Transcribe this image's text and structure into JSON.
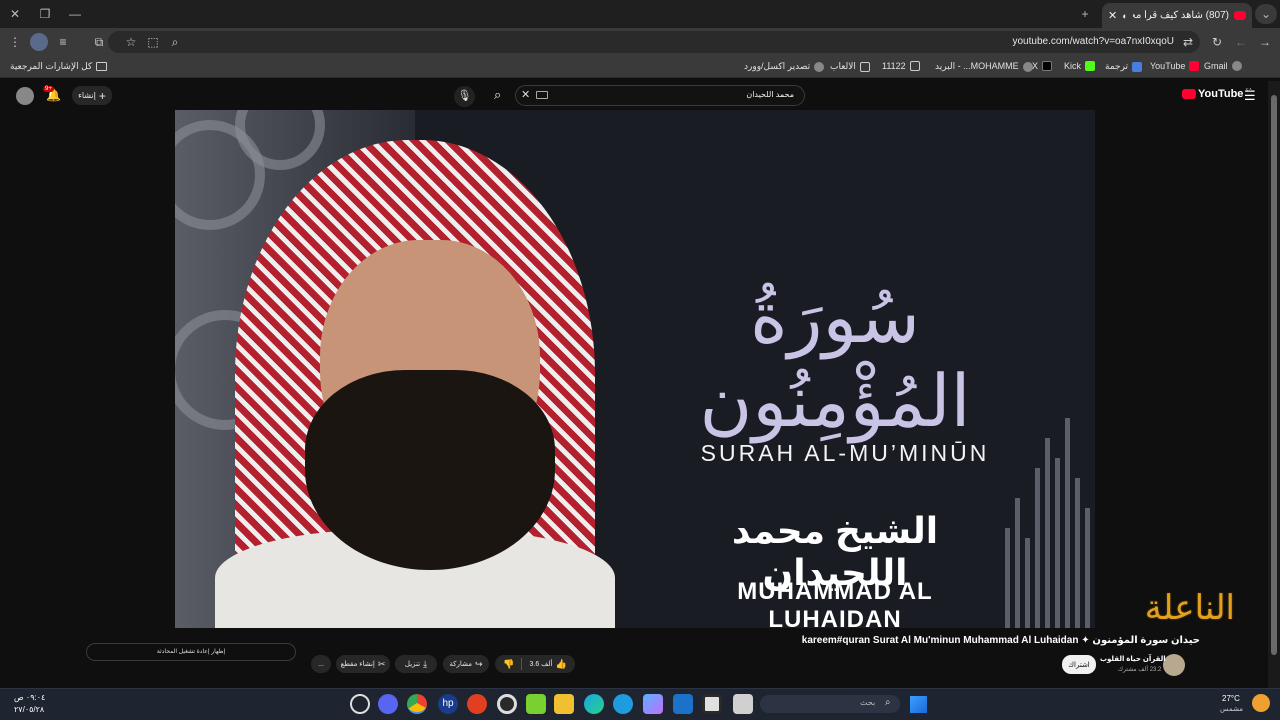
{
  "browser": {
    "tab_title": "(807) شاهد كيف قرأ محمد ال...",
    "new_tab_icon": "plus-icon",
    "url": "youtube.com/watch?v=oa7nxI0xqoU"
  },
  "bookmarks": {
    "all_bookmarks": "كل الإشارات المرجعية",
    "items": [
      "Gmail",
      "YouTube",
      "ترجمة",
      "Kick",
      "X",
      "البريد - ...MOHAMME",
      "11122",
      "الالعاب",
      "تصدير اكسل/وورد"
    ]
  },
  "youtube": {
    "logo": "YouTube",
    "country": "SA",
    "search_value": "محمد اللحيدان",
    "create_label": "إنشاء",
    "notifications_count": "9+"
  },
  "video": {
    "surah_ar": "سُورَةُ المُؤْمِنُون",
    "surah_en": "SURAH AL-MU’MINŪN",
    "sheikh_ar": "الشيخ محمد اللحيدان",
    "sheikh_en": "MUHAMMAD AL LUHAIDAN",
    "watermark": "الناعلة"
  },
  "below": {
    "title": "kareem#quran Surat Al Mu'minun Muhammad Al Luhaidan ✦ حيدان سورة المؤمنون",
    "channel_name": "القرآن حياة القلوب",
    "channel_subs": "23.2 ألف مشترك",
    "subscribe": "اشتراك",
    "likes": "3.6 ألف",
    "share": "مشاركة",
    "download": "تنزيل",
    "clip": "إنشاء مقطع",
    "more": "...",
    "chat_replay": "إظهار إعادة تشغيل المحادثة"
  },
  "taskbar": {
    "search_placeholder": "بحث",
    "weather_temp": "27°C",
    "weather_desc": "مشمس",
    "time": "٠٩:٠٤ ص",
    "date": "٢٧/٠٥/٢٨"
  },
  "colors": {
    "youtube_red": "#ff0033",
    "accent_gold": "#e0a020"
  }
}
